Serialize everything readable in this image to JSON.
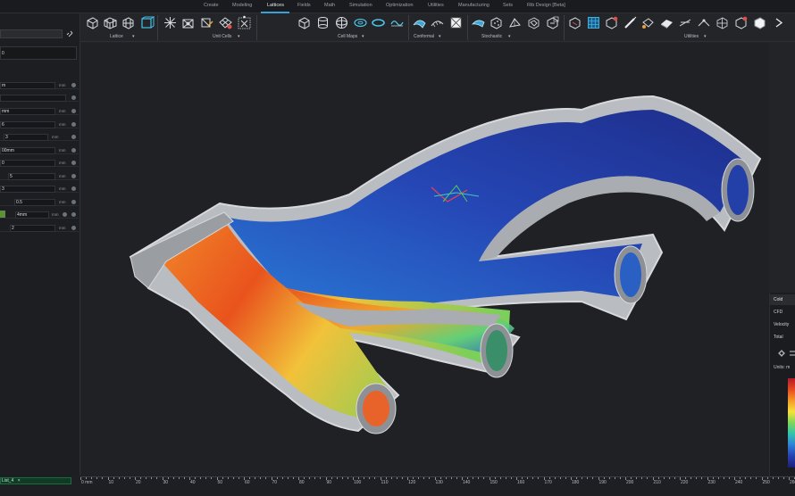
{
  "menu": {
    "tabs": [
      "Create",
      "Modeling",
      "Lattices",
      "Fields",
      "Math",
      "Simulation",
      "Optimization",
      "Utilities",
      "Manufacturing",
      "Sets",
      "Rib Design [Beta]"
    ],
    "active": "Lattices",
    "accent": "#3aa0d8"
  },
  "ribbon": {
    "groups": [
      "Lattice",
      "Unit Cells",
      "Cell Maps",
      "Conformal",
      "Stochastic",
      "Utilities"
    ]
  },
  "left_panel": {
    "name_field": "0",
    "rows": [
      {
        "value": "m",
        "unit": "mm"
      },
      {
        "value": "",
        "unit": ""
      },
      {
        "value": "mm",
        "unit": "mm"
      },
      {
        "value": "6",
        "unit": "mm"
      },
      {
        "value": "3",
        "unit": "mm"
      },
      {
        "value": "00mm",
        "unit": "mm"
      },
      {
        "value": "0",
        "unit": "mm"
      },
      {
        "value": "5",
        "unit": "mm"
      },
      {
        "value": "3",
        "unit": "mm"
      },
      {
        "value": "0.5",
        "unit": "mm"
      },
      {
        "value": "4mm",
        "unit": "mm"
      },
      {
        "value": "2",
        "unit": "mm"
      }
    ]
  },
  "status": {
    "list_tag": "List_4",
    "list_tag_close": "×"
  },
  "ruler": {
    "labels": [
      "0 mm",
      "10",
      "20",
      "30",
      "40",
      "50",
      "60",
      "70",
      "80",
      "90",
      "100",
      "110",
      "120",
      "130",
      "140",
      "150",
      "160",
      "170",
      "180",
      "190",
      "200",
      "210",
      "220",
      "230",
      "240",
      "250",
      "260"
    ]
  },
  "right_panel": {
    "header": "Cold",
    "items": [
      "CFD",
      "Velocity",
      "Total"
    ],
    "units_label": "Units: m"
  },
  "colors": {
    "background": "#222427",
    "viewport": "#1f2125",
    "shell": "#c4c6c9",
    "flow_hot": "#e84a1f",
    "flow_cold": "#263fb0"
  }
}
